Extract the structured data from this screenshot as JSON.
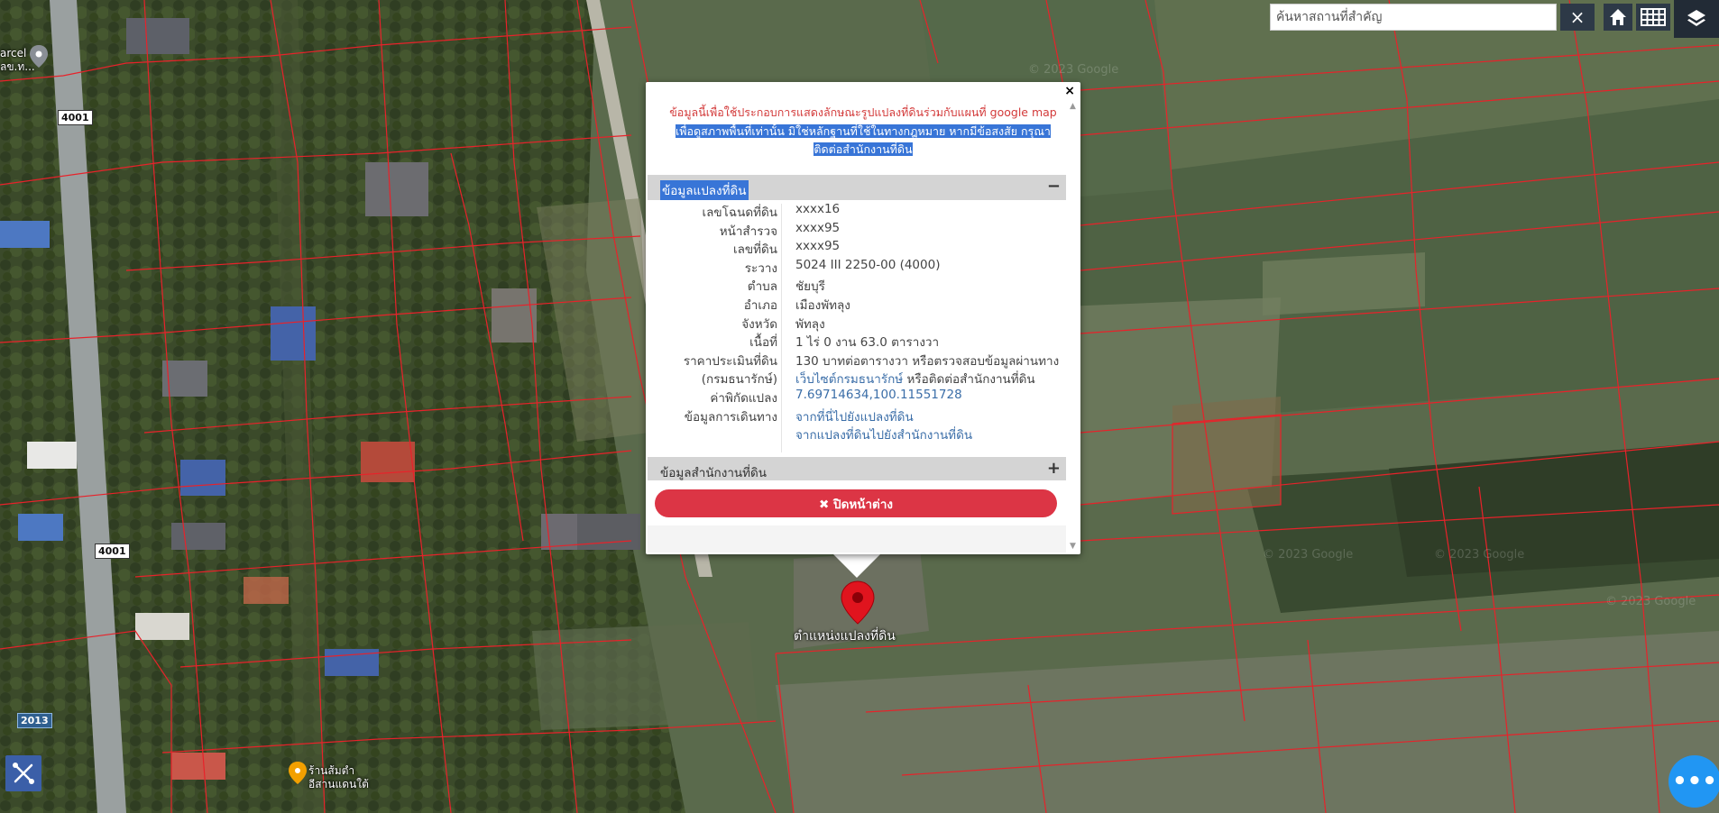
{
  "map": {
    "road_labels": [
      "4001",
      "4001",
      "2013"
    ],
    "place_labels": {
      "parcel_line1": "arcel",
      "parcel_line2": "ลข.ท...",
      "shop_line1": "ร้านส้มตำ",
      "shop_line2": "อีสานแดนใต้"
    },
    "watermarks": [
      "© 2023 Google",
      "© 2023 Google",
      "© 2023 Google",
      "© 2023 Google"
    ],
    "marker_label": "ตำแหน่งแปลงที่ดิน",
    "colors": {
      "parcel_line": "#e8222a",
      "marker": "#e0141e"
    }
  },
  "search": {
    "placeholder": "ค้นหาสถานที่สำคัญ",
    "clear_icon": "×"
  },
  "toolbar": {
    "home_icon": "home-icon",
    "grid_icon": "grid-icon",
    "layers_icon": "layers-icon"
  },
  "popup": {
    "close_icon": "×",
    "notice_line1": "ข้อมูลนี้เพื่อใช้ประกอบการแสดงลักษณะรูปแปลงที่ดินร่วมกับแผนที่ google map",
    "notice_line2": "เพื่อดูสภาพพื้นที่เท่านั้น มิใช่หลักฐานที่ใช้ในทางกฎหมาย หากมีข้อสงสัย กรุณา",
    "notice_line3": "ติดต่อสำนักงานที่ดิน",
    "section_parcel": "ข้อมูลแปลงที่ดิน",
    "section_parcel_sign": "−",
    "fields": [
      {
        "label": "เลขโฉนดที่ดิน",
        "value": "xxxx16"
      },
      {
        "label": "หน้าสำรวจ",
        "value": "xxxx95"
      },
      {
        "label": "เลขที่ดิน",
        "value": "xxxx95"
      },
      {
        "label": "ระวาง",
        "value": "5024 III 2250-00 (4000)"
      },
      {
        "label": "ตำบล",
        "value": "ชัยบุรี"
      },
      {
        "label": "อำเภอ",
        "value": "เมืองพัทลุง"
      },
      {
        "label": "จังหวัด",
        "value": "พัทลุง"
      },
      {
        "label": "เนื้อที่",
        "value": "1 ไร่ 0 งาน 63.0 ตารางวา"
      }
    ],
    "price_label1": "ราคาประเมินที่ดิน",
    "price_label2": "(กรมธนารักษ์)",
    "price_value1": "130 บาทต่อตารางวา หรือตรวจสอบข้อมูลผ่านทาง",
    "price_link": "เว็บไซต์กรมธนารักษ์",
    "price_value2": " หรือติดต่อสำนักงานที่ดิน",
    "coord_label": "ค่าพิกัดแปลง",
    "coord_value": "7.69714634,100.11551728",
    "route_label": "ข้อมูลการเดินทาง",
    "route_link1": "จากที่นี่ไปยังแปลงที่ดิน",
    "route_link2": "จากแปลงที่ดินไปยังสำนักงานที่ดิน",
    "section_office": "ข้อมูลสำนักงานที่ดิน",
    "section_office_sign": "+",
    "close_button": "✖ ปิดหน้าต่าง"
  },
  "more_button": "•••"
}
